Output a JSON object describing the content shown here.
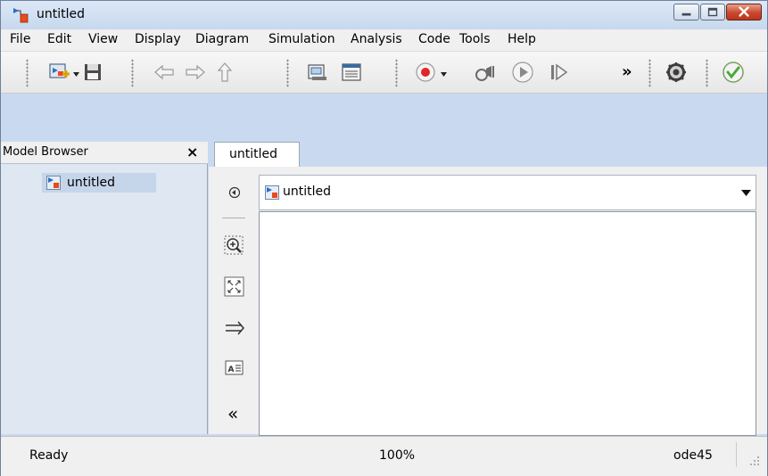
{
  "window": {
    "title": "untitled"
  },
  "menu": [
    "File",
    "Edit",
    "View",
    "Display",
    "Diagram",
    "Simulation",
    "Analysis",
    "Code",
    "Tools",
    "Help"
  ],
  "toolbar": {
    "overflow": "»"
  },
  "model_browser": {
    "title": "Model Browser",
    "close": "×",
    "items": [
      {
        "label": "untitled"
      }
    ]
  },
  "editor": {
    "tab": "untitled",
    "address": "untitled",
    "palette": {
      "collapse": "«"
    }
  },
  "status": {
    "state": "Ready",
    "zoom": "100%",
    "solver": "ode45"
  },
  "colors": {
    "frame": "#c9daf0",
    "browser": "#dee7f2",
    "selected": "#c5d5ea",
    "record": "#e0262b",
    "ok": "#4aa83a"
  }
}
